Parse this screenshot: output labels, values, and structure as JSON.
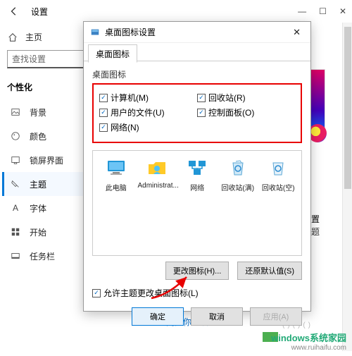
{
  "settings": {
    "title": "设置",
    "home": "主页",
    "search_placeholder": "查找设置",
    "section": "个性化",
    "nav": [
      {
        "label": "背景"
      },
      {
        "label": "颜色"
      },
      {
        "label": "锁屏界面"
      },
      {
        "label": "主题"
      },
      {
        "label": "字体"
      },
      {
        "label": "开始"
      },
      {
        "label": "任务栏"
      }
    ],
    "right_label_suffix": "置",
    "right_label_sub": "免费主题",
    "sync_link": "同步你的设置"
  },
  "dialog": {
    "title": "桌面图标设置",
    "tab": "桌面图标",
    "group_label": "桌面图标",
    "checks": {
      "computer": "计算机(M)",
      "recycle": "回收站(R)",
      "userfiles": "用户的文件(U)",
      "control": "控制面板(O)",
      "network": "网络(N)"
    },
    "icons": [
      {
        "label": "此电脑"
      },
      {
        "label": "Administrat..."
      },
      {
        "label": "网络"
      },
      {
        "label": "回收站(满)"
      },
      {
        "label": "回收站(空)"
      }
    ],
    "change_icon": "更改图标(H)...",
    "restore_default": "还原默认值(S)",
    "allow_theme": "允许主题更改桌面图标(L)",
    "ok": "确定",
    "cancel": "取消",
    "apply": "应用(A)"
  },
  "watermark": {
    "main": "windows系统家园",
    "sub": "www.ruihaifu.com"
  }
}
